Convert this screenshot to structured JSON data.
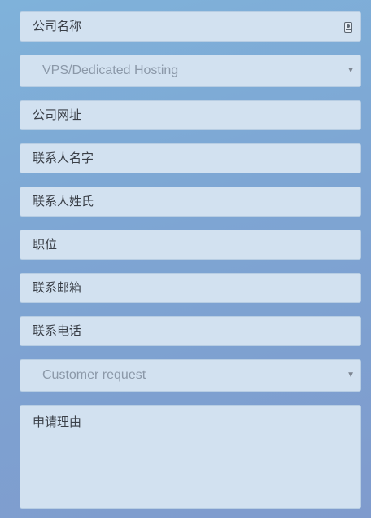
{
  "form": {
    "company_name": {
      "placeholder": "公司名称",
      "icon": "contact-card-icon"
    },
    "hosting_type": {
      "selected": "VPS/Dedicated Hosting",
      "icon": "chevron-down-icon"
    },
    "company_website": {
      "placeholder": "公司网址"
    },
    "contact_first_name": {
      "placeholder": "联系人名字"
    },
    "contact_last_name": {
      "placeholder": "联系人姓氏"
    },
    "job_title": {
      "placeholder": "职位"
    },
    "contact_email": {
      "placeholder": "联系邮箱"
    },
    "contact_phone": {
      "placeholder": "联系电话"
    },
    "request_type": {
      "selected": "Customer request",
      "icon": "chevron-down-icon"
    },
    "reason": {
      "placeholder": "申请理由"
    }
  }
}
